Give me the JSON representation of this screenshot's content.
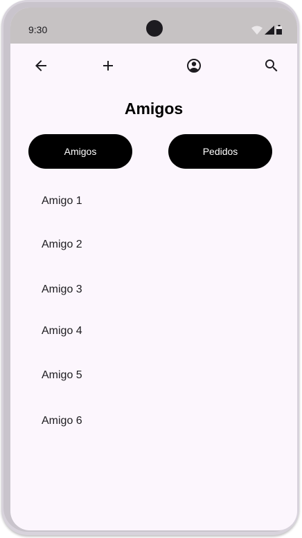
{
  "status": {
    "time": "9:30",
    "icons": [
      "wifi-icon",
      "cell-signal-icon",
      "battery-icon"
    ]
  },
  "toolbar": {
    "icons": [
      "back-arrow-icon",
      "add-icon",
      "account-circle-icon",
      "search-icon"
    ]
  },
  "page": {
    "title": "Amigos"
  },
  "tabs": [
    {
      "label": "Amigos"
    },
    {
      "label": "Pedidos"
    }
  ],
  "friends": [
    {
      "name": "Amigo 1"
    },
    {
      "name": "Amigo 2"
    },
    {
      "name": "Amigo 3"
    },
    {
      "name": "Amigo 4"
    },
    {
      "name": "Amigo 5"
    },
    {
      "name": "Amigo 6"
    }
  ],
  "colors": {
    "screen_background": "#fcf6fd",
    "status_bar": "#c6c2c3",
    "button_background": "#000000",
    "button_text": "#ffffff"
  }
}
